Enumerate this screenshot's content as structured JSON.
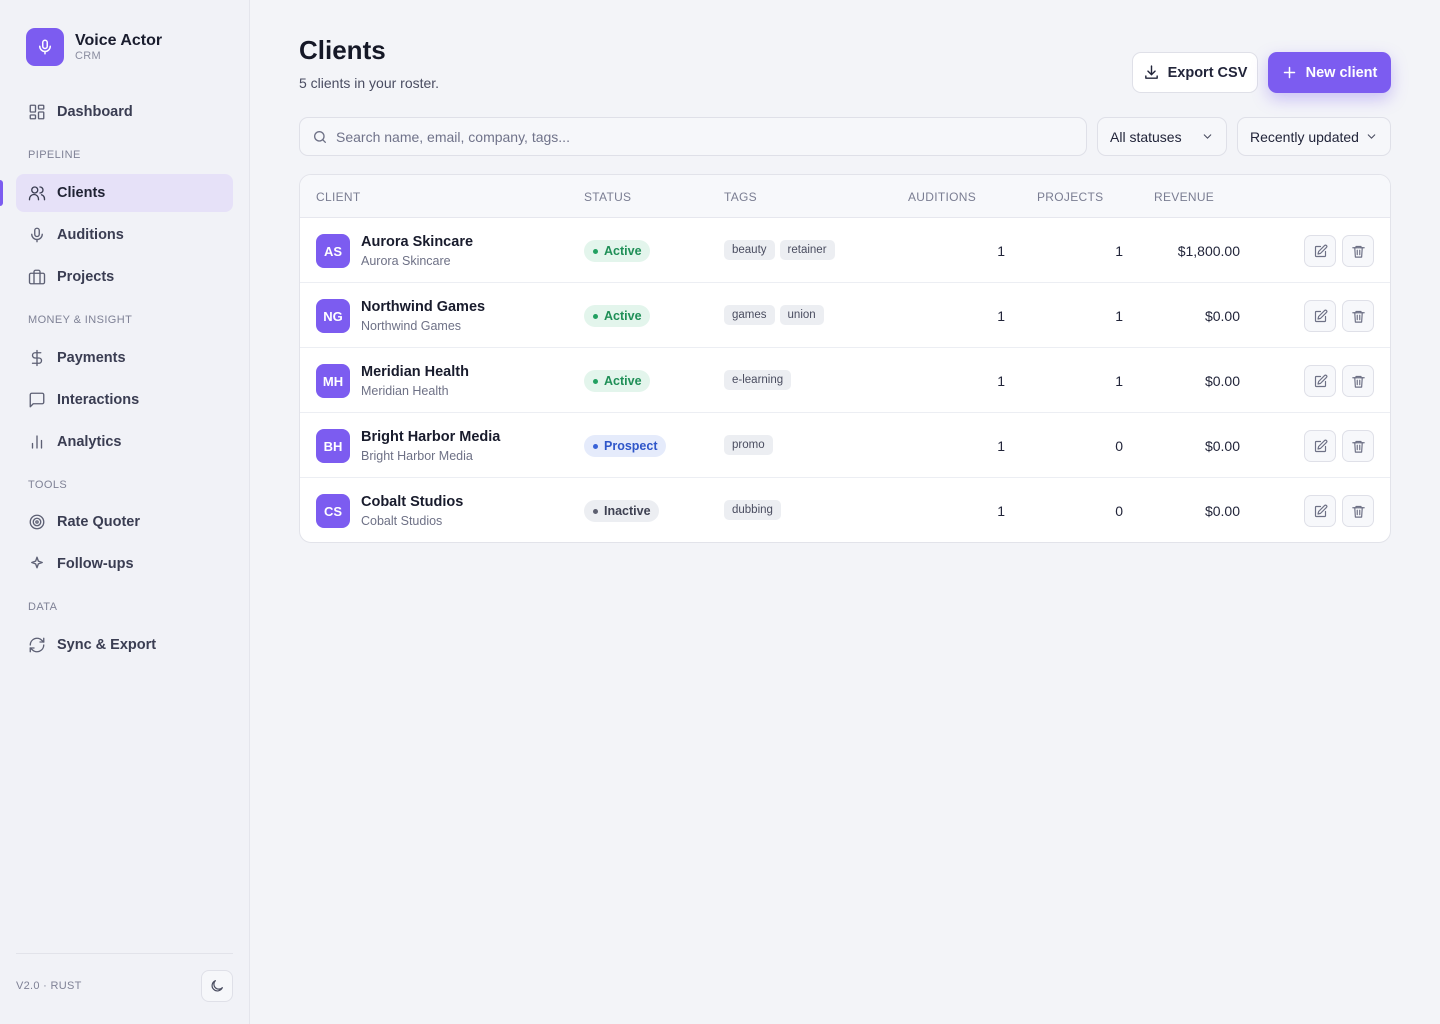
{
  "brand": {
    "name": "Voice Actor",
    "sub": "CRM",
    "icon": "microphone-icon"
  },
  "sidebar": {
    "items": [
      {
        "label": "Dashboard",
        "icon": "grid-icon"
      },
      {
        "label": "Clients",
        "icon": "users-icon"
      },
      {
        "label": "Auditions",
        "icon": "microphone-icon"
      },
      {
        "label": "Projects",
        "icon": "briefcase-icon"
      },
      {
        "label": "Payments",
        "icon": "dollar-icon"
      },
      {
        "label": "Interactions",
        "icon": "chat-icon"
      },
      {
        "label": "Analytics",
        "icon": "bar-chart-icon"
      },
      {
        "label": "Rate Quoter",
        "icon": "target-icon"
      },
      {
        "label": "Follow-ups",
        "icon": "sparkle-icon"
      },
      {
        "label": "Sync & Export",
        "icon": "refresh-icon"
      }
    ],
    "sections": {
      "pipeline": "PIPELINE",
      "money": "MONEY & INSIGHT",
      "tools": "TOOLS",
      "data": "DATA"
    },
    "active": "Clients",
    "version": "V2.0 · RUST"
  },
  "header": {
    "title": "Clients",
    "subtitle": "5 clients in your roster.",
    "export_label": "Export CSV",
    "new_label": "New client"
  },
  "filters": {
    "search_placeholder": "Search name, email, company, tags...",
    "status": "All statuses",
    "sort": "Recently updated"
  },
  "table": {
    "columns": [
      "CLIENT",
      "STATUS",
      "TAGS",
      "AUDITIONS",
      "PROJECTS",
      "REVENUE"
    ],
    "rows": [
      {
        "initials": "AS",
        "name": "Aurora Skincare",
        "company": "Aurora Skincare",
        "status": "Active",
        "tags": [
          "beauty",
          "retainer"
        ],
        "auditions": "1",
        "projects": "1",
        "revenue": "$1,800.00"
      },
      {
        "initials": "NG",
        "name": "Northwind Games",
        "company": "Northwind Games",
        "status": "Active",
        "tags": [
          "games",
          "union"
        ],
        "auditions": "1",
        "projects": "1",
        "revenue": "$0.00"
      },
      {
        "initials": "MH",
        "name": "Meridian Health",
        "company": "Meridian Health",
        "status": "Active",
        "tags": [
          "e-learning"
        ],
        "auditions": "1",
        "projects": "1",
        "revenue": "$0.00"
      },
      {
        "initials": "BH",
        "name": "Bright Harbor Media",
        "company": "Bright Harbor Media",
        "status": "Prospect",
        "tags": [
          "promo"
        ],
        "auditions": "1",
        "projects": "0",
        "revenue": "$0.00"
      },
      {
        "initials": "CS",
        "name": "Cobalt Studios",
        "company": "Cobalt Studios",
        "status": "Inactive",
        "tags": [
          "dubbing"
        ],
        "auditions": "1",
        "projects": "0",
        "revenue": "$0.00"
      }
    ]
  },
  "colors": {
    "accent": "#7c5cf0",
    "active": "#22a061",
    "prospect": "#3a63d8",
    "inactive": "#5d6070"
  }
}
